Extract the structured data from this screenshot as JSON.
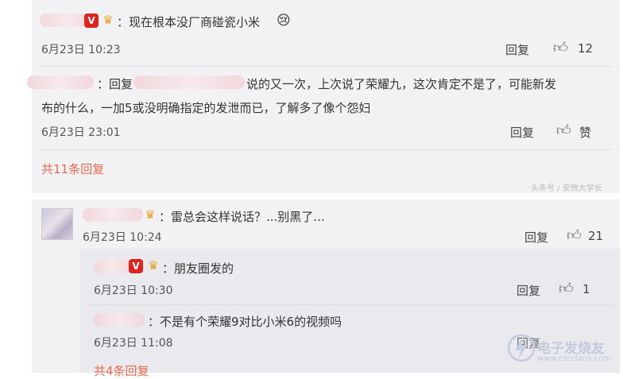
{
  "comments": [
    {
      "text": "：现在根本没厂商碰瓷小米",
      "emoji": "😢",
      "time": "6月23日 10:23",
      "reply_label": "回复",
      "like_count": "12"
    },
    {
      "reply_prefix": "：回复",
      "text_part": "说的又一次，上次说了荣耀九，这次肯定不是了，可能新发",
      "text_line2": "布的什么，一加5或没明确指定的发泄而已，了解多了像个怨妇",
      "time": "6月23日 23:01",
      "reply_label": "回复",
      "like_label": "赞"
    },
    {
      "more_replies": "共11条回复",
      "watermark": "头条号 / 安微大学长"
    },
    {
      "text": "：雷总会这样说话？...别黑了...",
      "time": "6月23日 10:24",
      "reply_label": "回复",
      "like_count": "21"
    },
    {
      "badge": "V",
      "text": "：朋友圈发的",
      "time": "6月23日 10:30",
      "reply_label": "回复",
      "like_count": "1"
    },
    {
      "text": "：不是有个荣耀9对比小米6的视频吗",
      "time": "6月23日 11:08",
      "reply_label": "回复",
      "more_replies": "共4条回复"
    }
  ],
  "logo": {
    "text_main": "电子发烧友",
    "text_url": "www.elecfans.com"
  },
  "icons": {
    "like": "thumbs-up-icon",
    "vip": "crown-icon",
    "verified": "v-badge-icon"
  },
  "colors": {
    "link": "#e86a4c",
    "badge": "#e0231c",
    "crown": "#e8a02a",
    "panel": "#f2f2f5"
  }
}
